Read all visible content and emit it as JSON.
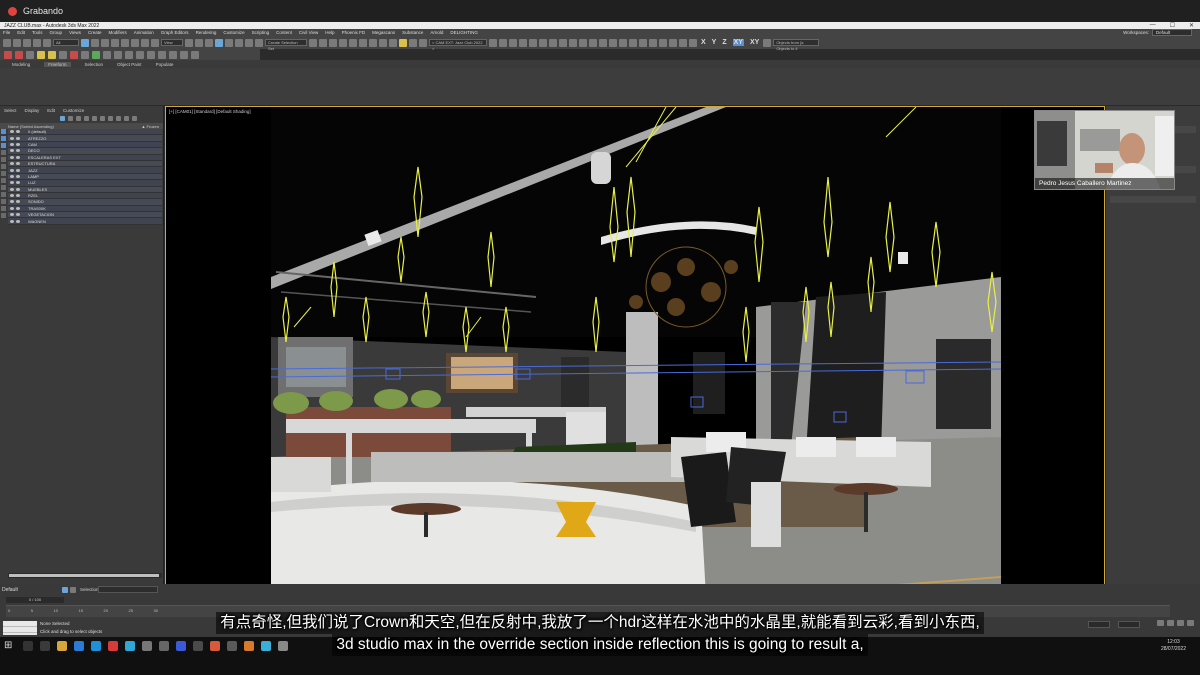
{
  "recording": {
    "label": "Grabando"
  },
  "window": {
    "title": "JAZZ CLUB.max - Autodesk 3ds Max 2022"
  },
  "menu": [
    "File",
    "Edit",
    "Tools",
    "Group",
    "Views",
    "Create",
    "Modifiers",
    "Animation",
    "Graph Editors",
    "Rendering",
    "Customize",
    "Scripting",
    "Content",
    "Civil View",
    "Help",
    "Phoenix FD",
    "Megascans",
    "Substance",
    "Arnold",
    "DELIGHTING"
  ],
  "workspace": {
    "label": "Workspaces:",
    "value": "Default"
  },
  "toolbar": {
    "view_dropdown": "All",
    "ref_dropdown": "View",
    "create_selection": "Create Selection Set",
    "camera_dropdown": "< CAM EXT: Jazz Club 2022 >",
    "axes": [
      "X",
      "Y",
      "Z",
      "XY",
      "XY"
    ],
    "objects_from": "Objects from [a Objects to 4"
  },
  "ribbon": {
    "tabs": [
      "Modeling",
      "Freeform",
      "Selection",
      "Object Paint",
      "Populate"
    ],
    "active": "Freeform"
  },
  "explorer": {
    "menu": [
      "Select",
      "Display",
      "Edit",
      "Customize"
    ],
    "header": "Name (Sorted Ascending)",
    "frozen": "▲ Frozen",
    "layers": [
      "0 (default)",
      "ATREZZO",
      "CAM",
      "DECO",
      "ESCALERAS EXT",
      "ESTRUCTURA",
      "JAZZ",
      "LAMP",
      "LUZ",
      "MUEBLES",
      "RZEL",
      "SONIDO",
      "TRAS00K",
      "VEGETACION",
      "WAGNEN"
    ]
  },
  "viewport": {
    "label": "[+] [CAM01] [Standard] [Default Shading]"
  },
  "webcam": {
    "name": "Pedro Jesus Caballero Martinez"
  },
  "bottom": {
    "layer": "Default",
    "selection_set": "Selection Set:",
    "frame_counter": "0 / 100",
    "ticks": [
      "0",
      "5",
      "10",
      "15",
      "20",
      "25",
      "30"
    ],
    "status_none": "None Selected",
    "status_hint": "Click and drag to select objects"
  },
  "taskbar": {
    "time": "12:03",
    "date": "28/07/2022"
  },
  "subtitles": {
    "zh": "有点奇怪,但我们说了Crown和天空,但在反射中,我放了一个hdr这样在水池中的水晶里,就能看到云彩,看到小东西,",
    "en": "3d studio max in the override section inside reflection this is going to result a,"
  }
}
